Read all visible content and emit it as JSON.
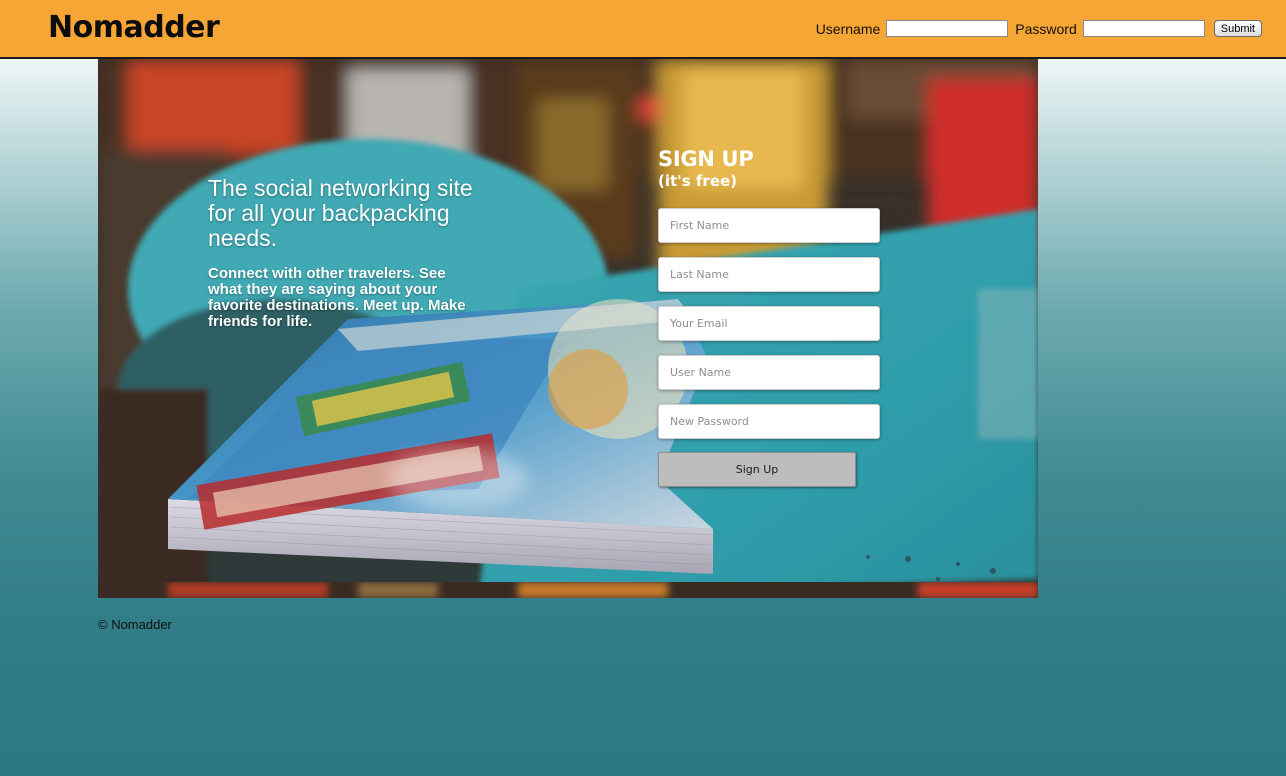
{
  "header": {
    "logo": "Nomadder",
    "username_label": "Username",
    "password_label": "Password",
    "username_value": "",
    "password_value": "",
    "submit_label": "Submit"
  },
  "hero": {
    "tagline": "The social networking site for all your backpacking needs.",
    "description": "Connect with other travelers. See what they are saying about your favorite destinations. Meet up. Make friends for life."
  },
  "signup": {
    "title": "SIGN UP",
    "subtitle": "(it's free)",
    "first_name_placeholder": "First Name",
    "last_name_placeholder": "Last Name",
    "email_placeholder": "Your Email",
    "username_placeholder": "User Name",
    "password_placeholder": "New Password",
    "button_label": "Sign Up"
  },
  "footer": {
    "copyright": "© Nomadder"
  },
  "colors": {
    "header_bg": "#f6a635",
    "page_bg_bottom": "#2c7884"
  }
}
